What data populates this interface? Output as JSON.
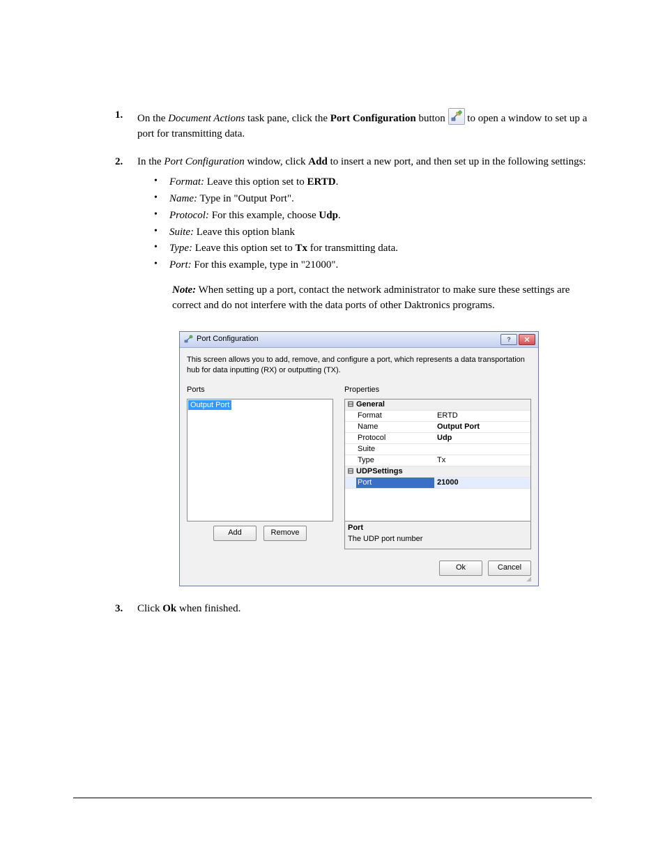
{
  "step1": {
    "num": "1.",
    "pre": "On the ",
    "doc_actions": "Document Actions",
    "mid1": " task pane, click the ",
    "port_config_bold": "Port Configuration",
    "mid2": " button ",
    "post": " to open a window to set up a port for transmitting data."
  },
  "step2": {
    "num": "2.",
    "pre": "In the ",
    "port_config_italic": "Port Configuration",
    "mid": " window, click ",
    "add_bold": "Add",
    "post": " to insert a new port, and then set up in the following settings:"
  },
  "bullets": {
    "format_i": "Format:",
    "format_txt": " Leave this option set to ",
    "format_bold": "ERTD",
    "format_end": ".",
    "name_i": "Name:",
    "name_txt": " Type in \"Output Port\".",
    "protocol_i": "Protocol:",
    "protocol_txt": " For this example, choose ",
    "protocol_bold": "Udp",
    "protocol_end": ".",
    "suite_i": "Suite:",
    "suite_txt": " Leave this option blank",
    "type_i": "Type:",
    "type_txt": " Leave this option set to ",
    "type_bold": "Tx",
    "type_end": " for transmitting data.",
    "port_i": "Port:",
    "port_txt": " For this example, type in \"21000\"."
  },
  "note": {
    "label": "Note:",
    "text": " When setting up a port, contact the network administrator to make sure these settings are correct and do not interfere with the data ports of other Daktronics programs."
  },
  "dialog": {
    "title": "Port Configuration",
    "desc": "This screen allows you to add, remove, and configure a port, which represents a data transportation hub for data inputting (RX) or outputting (TX).",
    "ports_label": "Ports",
    "properties_label": "Properties",
    "list_item": "Output Port",
    "add_btn": "Add",
    "remove_btn": "Remove",
    "group_general": "General",
    "row_format_l": "Format",
    "row_format_v": "ERTD",
    "row_name_l": "Name",
    "row_name_v": "Output Port",
    "row_protocol_l": "Protocol",
    "row_protocol_v": "Udp",
    "row_suite_l": "Suite",
    "row_suite_v": "",
    "row_type_l": "Type",
    "row_type_v": "Tx",
    "group_udp": "UDPSettings",
    "row_port_l": "Port",
    "row_port_v": "21000",
    "desc_title": "Port",
    "desc_text": "The UDP port number",
    "ok_btn": "Ok",
    "cancel_btn": "Cancel"
  },
  "step3": {
    "num": "3.",
    "pre": "Click ",
    "ok_bold": "Ok",
    "post": " when finished."
  }
}
